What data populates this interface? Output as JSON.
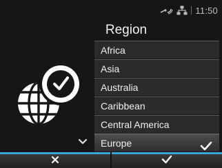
{
  "status_bar": {
    "time": "11:50",
    "icons": [
      "wifi-signal-icon",
      "network-icon"
    ]
  },
  "header": {
    "title": "Region"
  },
  "region_list": {
    "items": [
      {
        "label": "Africa",
        "selected": false
      },
      {
        "label": "Asia",
        "selected": false
      },
      {
        "label": "Australia",
        "selected": false
      },
      {
        "label": "Caribbean",
        "selected": false
      },
      {
        "label": "Central America",
        "selected": false
      },
      {
        "label": "Europe",
        "selected": true
      }
    ],
    "scroll_indicator_icon": "chevron-down-icon",
    "selected_icon": "checkmark-icon"
  },
  "illustration": {
    "icon": "globe-clock-icon"
  },
  "bottom_bar": {
    "cancel_icon": "close-icon",
    "confirm_icon": "checkmark-icon"
  },
  "colors": {
    "accent": "#3aa6d6",
    "background": "#161616",
    "list_item": "#2b2b2b",
    "selected_item": "#4c4c4c"
  }
}
